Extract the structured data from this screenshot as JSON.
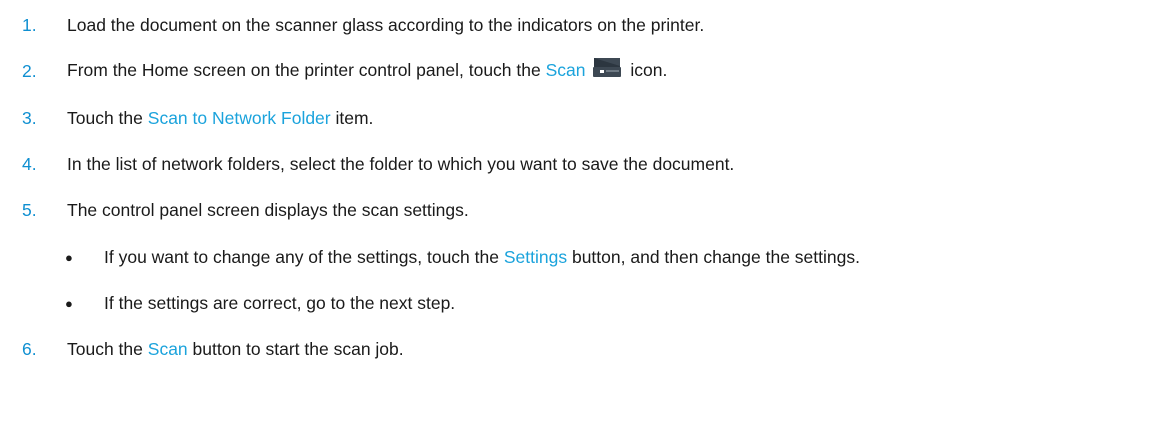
{
  "steps": [
    {
      "num": "1.",
      "text": "Load the document on the scanner glass according to the indicators on the printer."
    },
    {
      "num": "2.",
      "pre": "From the Home screen on the printer control panel, touch the",
      "link": "Scan",
      "icon": "scan-icon",
      "post": "icon."
    },
    {
      "num": "3.",
      "pre": "Touch the",
      "link": "Scan to Network Folder",
      "post": "item."
    },
    {
      "num": "4.",
      "text": "In the list of network folders, select the folder to which you want to save the document."
    },
    {
      "num": "5.",
      "text": "The control panel screen displays the scan settings."
    },
    {
      "num": "6.",
      "pre": "Touch the",
      "link": "Scan",
      "post": "button to start the scan job."
    }
  ],
  "substeps": [
    {
      "bullet": "●",
      "pre": "If you want to change any of the settings, touch the",
      "link": "Settings",
      "post": "button, and then change the settings."
    },
    {
      "bullet": "●",
      "text": "If the settings are correct, go to the next step."
    }
  ],
  "colors": {
    "accent": "#0f8fd1",
    "link": "#1ba3dc",
    "text": "#1a1a1a"
  }
}
